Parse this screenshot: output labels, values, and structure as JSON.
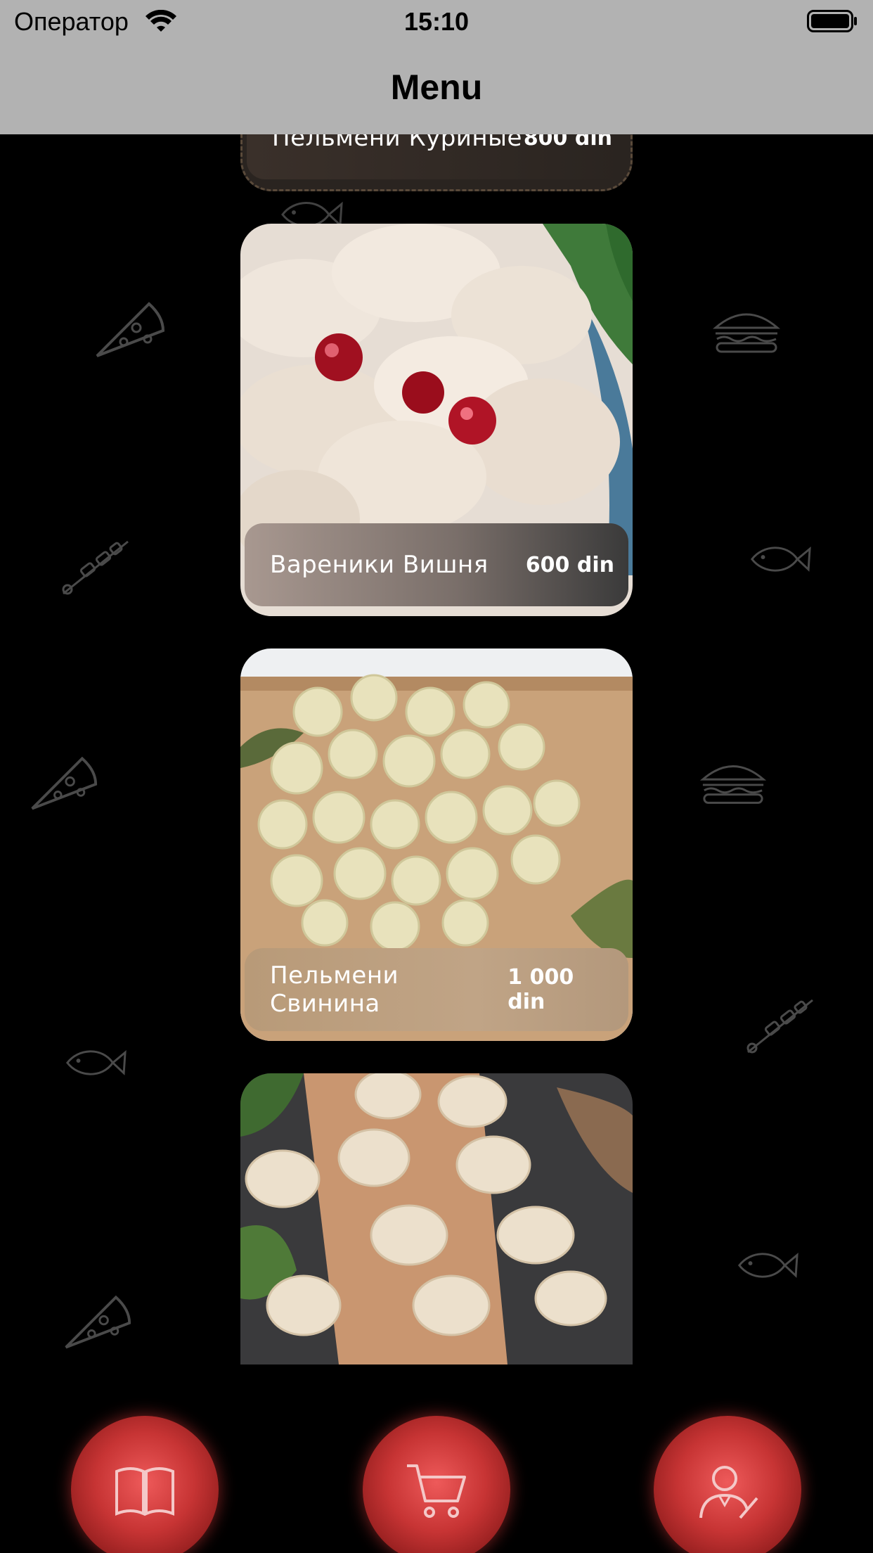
{
  "status_bar": {
    "carrier": "Оператор",
    "time": "15:10"
  },
  "nav": {
    "title": "Menu"
  },
  "menu_items": [
    {
      "name": "Пельмени Куриные",
      "price": "800 din"
    },
    {
      "name": "Вареники Вишня",
      "price": "600 din"
    },
    {
      "name": "Пельмени Свинина",
      "price": "1 000 din"
    },
    {
      "name": "",
      "price": ""
    }
  ],
  "bottom_bar": {
    "buttons": [
      {
        "icon": "book-icon"
      },
      {
        "icon": "cart-icon"
      },
      {
        "icon": "chef-profile-icon"
      }
    ]
  },
  "colors": {
    "nav_bg": "#b2b2b2",
    "page_bg": "#000000",
    "button_red": "#c73434"
  }
}
